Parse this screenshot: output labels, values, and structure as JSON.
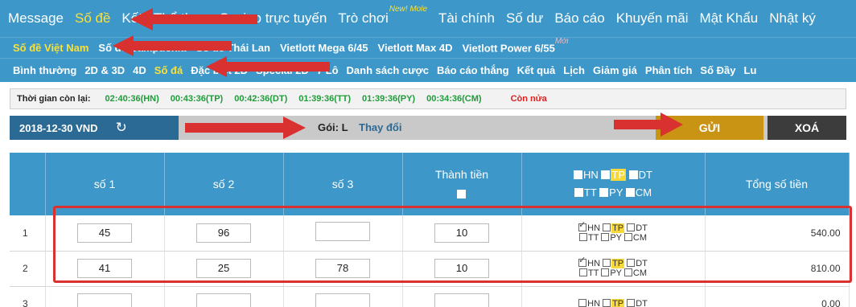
{
  "topnav": {
    "items": [
      {
        "label": "Message"
      },
      {
        "label": "Số đề",
        "active": true
      },
      {
        "label": "Kết"
      },
      {
        "label": "Thể thao"
      },
      {
        "label": "Casino trực tuyến"
      },
      {
        "label": "Trò chơi",
        "badge": "New! Mole"
      },
      {
        "label": "Tài chính"
      },
      {
        "label": "Số dư"
      },
      {
        "label": "Báo cáo"
      },
      {
        "label": "Khuyến mãi"
      },
      {
        "label": "Mật Khẩu"
      },
      {
        "label": "Nhật ký"
      }
    ]
  },
  "subnav1": {
    "items": [
      {
        "label": "Số đề Việt Nam",
        "active": true
      },
      {
        "label": "Số đề Campuchia"
      },
      {
        "label": "Số đề Thái Lan"
      },
      {
        "label": "Vietlott Mega 6/45"
      },
      {
        "label": "Vietlott Max 4D"
      },
      {
        "label": "Vietlott Power 6/55",
        "badge": "Mới"
      }
    ]
  },
  "subnav2": {
    "items": [
      {
        "label": "Bình thường"
      },
      {
        "label": "2D & 3D"
      },
      {
        "label": "4D"
      },
      {
        "label": "Số đá",
        "active": true
      },
      {
        "label": "Đặc biệt 2D"
      },
      {
        "label": "Special 2D"
      },
      {
        "label": "7 Lô"
      },
      {
        "label": "Danh sách cược"
      },
      {
        "label": "Báo cáo thắng"
      },
      {
        "label": "Kết quả"
      },
      {
        "label": "Lịch"
      },
      {
        "label": "Giảm giá"
      },
      {
        "label": "Phân tích"
      },
      {
        "label": "Số Đầy"
      },
      {
        "label": "Lu"
      }
    ]
  },
  "timebar": {
    "label": "Thời gian còn lại:",
    "times": [
      {
        "text": "02:40:36(HN)"
      },
      {
        "text": "00:43:36(TP)"
      },
      {
        "text": "00:42:36(DT)"
      },
      {
        "text": "01:39:36(TT)"
      },
      {
        "text": "01:39:36(PY)"
      },
      {
        "text": "00:34:36(CM)"
      }
    ],
    "more": "Còn nửa"
  },
  "actionbar": {
    "date": "2018-12-30 VND",
    "package_label": "Gói: L",
    "change_label": "Thay đổi",
    "send_label": "GỬI",
    "clear_label": "XOÁ"
  },
  "table": {
    "headers": {
      "n1": "số 1",
      "n2": "số 2",
      "n3": "số 3",
      "amount": "Thành tiền",
      "total": "Tổng số tiền",
      "hn": "HN",
      "tp": "TP",
      "dt": "DT",
      "tt": "TT",
      "py": "PY",
      "cm": "CM"
    },
    "rows": [
      {
        "idx": "1",
        "n1": "45",
        "n2": "96",
        "n3": "",
        "amount": "10",
        "hn": true,
        "total": "540.00"
      },
      {
        "idx": "2",
        "n1": "41",
        "n2": "25",
        "n3": "78",
        "amount": "10",
        "hn": true,
        "total": "810.00"
      },
      {
        "idx": "3",
        "n1": "",
        "n2": "",
        "n3": "",
        "amount": "",
        "hn": false,
        "total": "0.00"
      }
    ]
  },
  "colors": {
    "nav_bg": "#3d97c8",
    "active": "#f9e13a",
    "send_button": "#c99313",
    "clear_button": "#3c3c3c",
    "annotation": "#d9312f"
  }
}
